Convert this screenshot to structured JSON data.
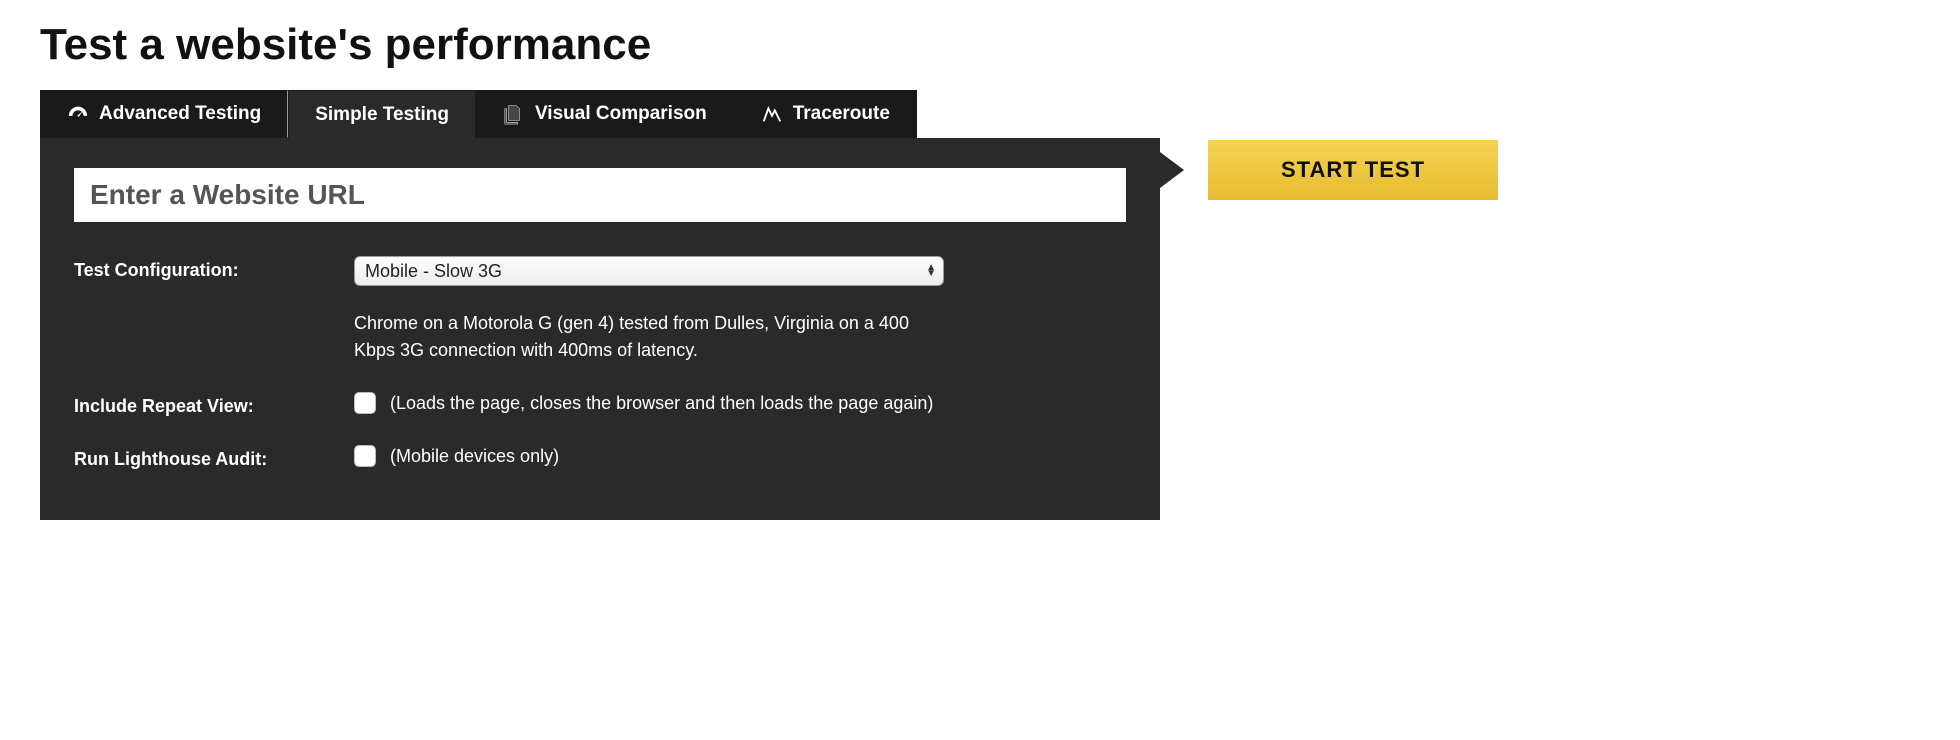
{
  "page": {
    "title": "Test a website's performance"
  },
  "tabs": {
    "advanced": "Advanced Testing",
    "simple": "Simple Testing",
    "visual": "Visual Comparison",
    "traceroute": "Traceroute"
  },
  "form": {
    "url_placeholder": "Enter a Website URL",
    "config_label": "Test Configuration:",
    "config_selected": "Mobile - Slow 3G",
    "config_description": "Chrome on a Motorola G (gen 4) tested from Dulles, Virginia on a 400 Kbps 3G connection with 400ms of latency.",
    "repeat_label": "Include Repeat View:",
    "repeat_note": "(Loads the page, closes the browser and then loads the page again)",
    "lighthouse_label": "Run Lighthouse Audit:",
    "lighthouse_note": "(Mobile devices only)"
  },
  "actions": {
    "start": "START TEST"
  }
}
